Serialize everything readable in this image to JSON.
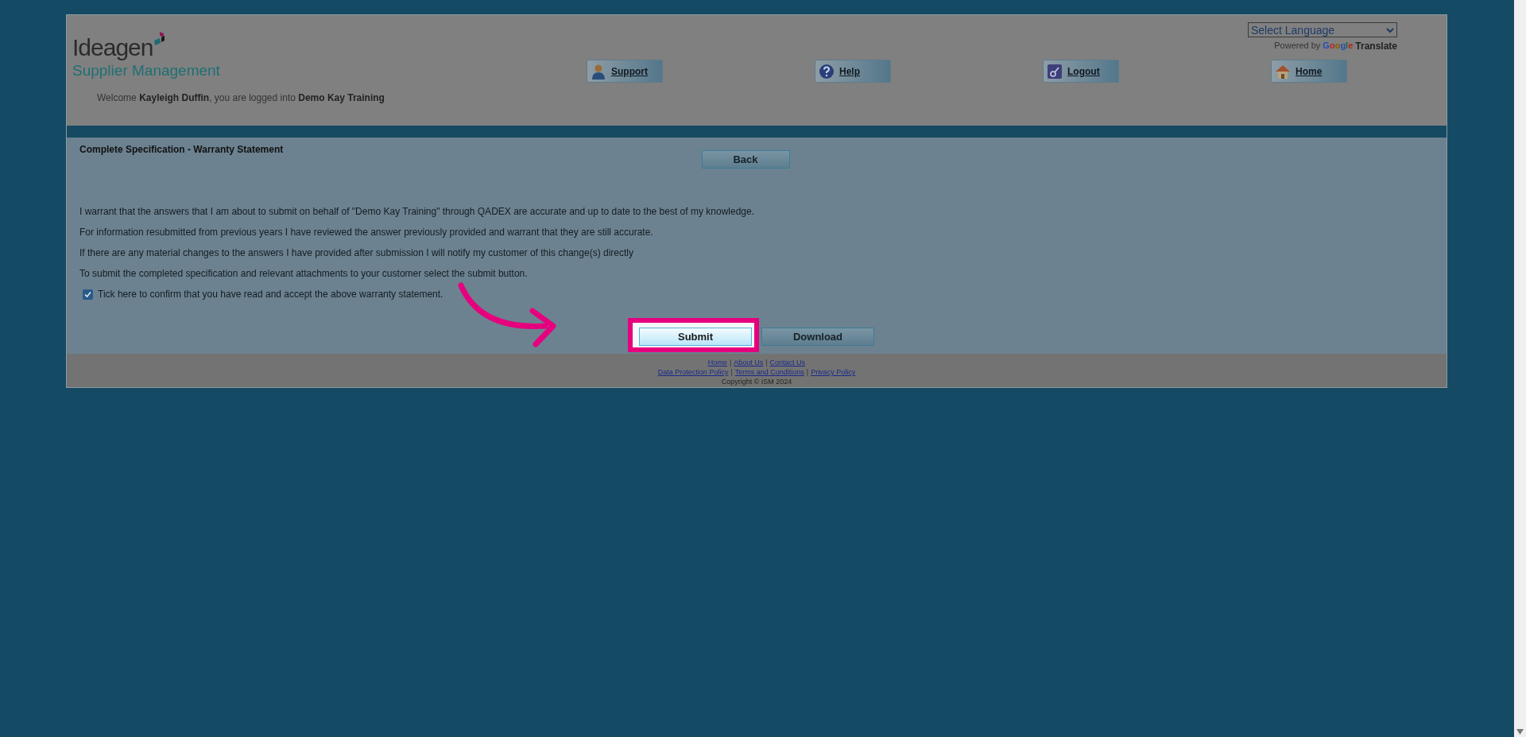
{
  "header": {
    "logo": {
      "name": "Ideagen",
      "subtitle": "Supplier Management"
    },
    "language_select": {
      "value": "Select Language"
    },
    "translate_credit": {
      "prefix": "Powered by",
      "brand": "Google",
      "suffix": "Translate"
    },
    "nav": [
      {
        "label": "Support",
        "kind": "person"
      },
      {
        "label": "Help",
        "kind": "help"
      },
      {
        "label": "Logout",
        "kind": "logout"
      },
      {
        "label": "Home",
        "kind": "home"
      }
    ],
    "welcome": "Welcome **Kayleigh Duffin**, you are logged into **Demo Kay Training**"
  },
  "content": {
    "title": "Complete Specification  - Warranty Statement",
    "back_button": "Back",
    "paragraphs": [
      "I warrant that the answers that I am about to submit on behalf of \"Demo Kay Training\" through QADEX are accurate and up to date to the best of my knowledge.",
      "For information resubmitted from previous years I have reviewed the answer previously provided and warrant that they are still accurate.",
      "If there are any material changes to the answers I have provided after submission I will notify my customer of this change(s) directly",
      "To submit the completed specification and relevant attachments to your customer select the submit button."
    ],
    "confirm_checkbox": {
      "label": "Tick here to confirm that you have read and accept the above warranty statement.",
      "checked": true
    },
    "buttons": [
      {
        "label": "Submit",
        "highlighted": true
      },
      {
        "label": "Download",
        "highlighted": false
      }
    ]
  },
  "footer": {
    "link_rows": [
      {
        "links": [
          "Home",
          "About Us",
          "Contact Us"
        ],
        "separator": "|"
      },
      {
        "links": [
          "Data Protection Policy",
          "Terms and Conditions",
          "Privacy Policy"
        ],
        "separator": "|"
      }
    ],
    "copyright": "Copyright © ISM 2024"
  }
}
